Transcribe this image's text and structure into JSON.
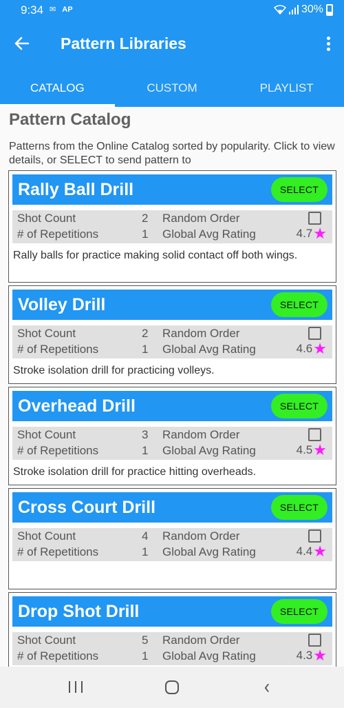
{
  "status_bar": {
    "time": "9:34",
    "notifications": [
      "✉",
      "AP"
    ],
    "battery": "30%"
  },
  "app_bar": {
    "title": "Pattern Libraries"
  },
  "tabs": [
    {
      "label": "CATALOG",
      "active": true
    },
    {
      "label": "CUSTOM",
      "active": false
    },
    {
      "label": "PLAYLIST",
      "active": false
    }
  ],
  "page": {
    "heading": "Pattern Catalog",
    "intro": "Patterns from the Online Catalog sorted by popularity. Click to view details, or SELECT to send  pattern to"
  },
  "labels": {
    "shot_count": "Shot Count",
    "repetitions": "# of Repetitions",
    "random_order": "Random Order",
    "global_rating": "Global Avg Rating",
    "select": "SELECT"
  },
  "colors": {
    "primary": "#2196f3",
    "select_button": "#33ee22",
    "star": "#ff1aff"
  },
  "patterns": [
    {
      "name": "Rally Ball Drill",
      "shot_count": "2",
      "repetitions": "1",
      "random_order": false,
      "rating": "4.7",
      "description": "Rally balls for practice making solid contact off both wings."
    },
    {
      "name": "Volley Drill",
      "shot_count": "2",
      "repetitions": "1",
      "random_order": false,
      "rating": "4.6",
      "description": "Stroke isolation drill for practicing volleys."
    },
    {
      "name": "Overhead Drill",
      "shot_count": "3",
      "repetitions": "1",
      "random_order": false,
      "rating": "4.5",
      "description": "Stroke isolation drill for practice hitting overheads."
    },
    {
      "name": "Cross Court Drill",
      "shot_count": "4",
      "repetitions": "1",
      "random_order": false,
      "rating": "4.4",
      "description": ""
    },
    {
      "name": "Drop Shot Drill",
      "shot_count": "5",
      "repetitions": "1",
      "random_order": false,
      "rating": "4.3",
      "description": ""
    }
  ]
}
